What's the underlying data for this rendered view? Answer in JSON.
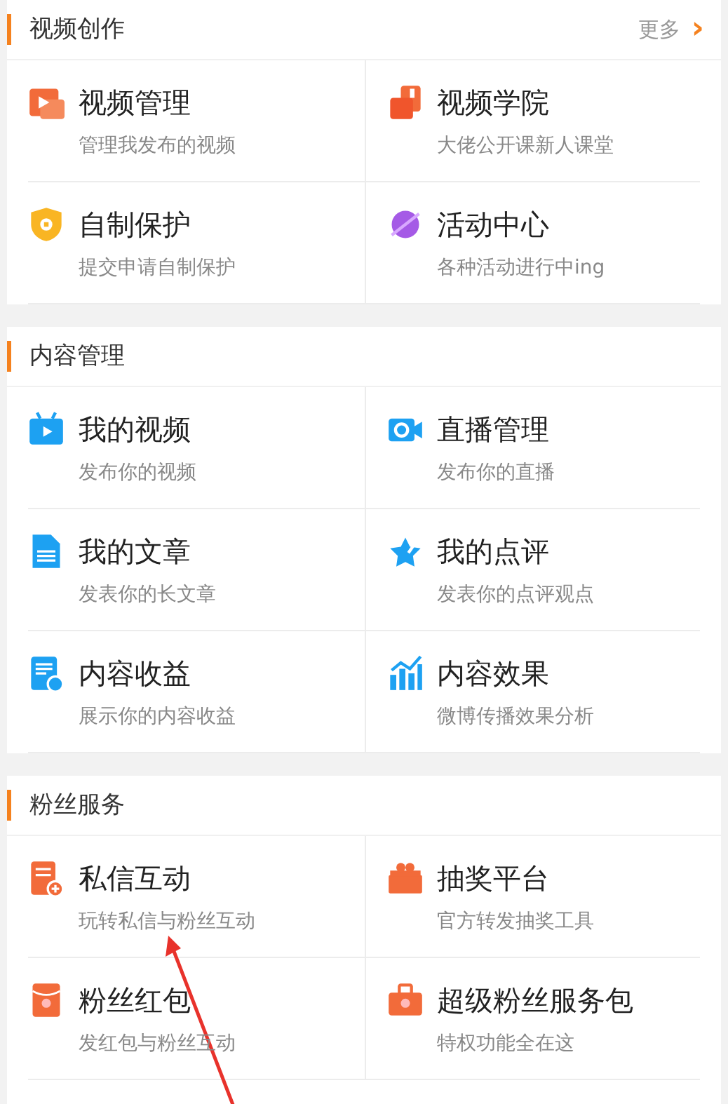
{
  "sections": [
    {
      "title": "视频创作",
      "more": {
        "label": "更多",
        "icon": "›"
      },
      "items": [
        {
          "kind": "play-folder",
          "title": "视频管理",
          "subtitle": "管理我发布的视频"
        },
        {
          "kind": "book",
          "title": "视频学院",
          "subtitle": "大佬公开课新人课堂"
        },
        {
          "kind": "shield",
          "title": "自制保护",
          "subtitle": "提交申请自制保护"
        },
        {
          "kind": "planet",
          "title": "活动中心",
          "subtitle": "各种活动进行中ing"
        }
      ]
    },
    {
      "title": "内容管理",
      "items": [
        {
          "kind": "tv",
          "title": "我的视频",
          "subtitle": "发布你的视频"
        },
        {
          "kind": "camera",
          "title": "直播管理",
          "subtitle": "发布你的直播"
        },
        {
          "kind": "document",
          "title": "我的文章",
          "subtitle": "发表你的长文章"
        },
        {
          "kind": "star",
          "title": "我的点评",
          "subtitle": "发表你的点评观点"
        },
        {
          "kind": "doc-yen",
          "title": "内容收益",
          "subtitle": "展示你的内容收益"
        },
        {
          "kind": "chart",
          "title": "内容效果",
          "subtitle": "微博传播效果分析"
        }
      ]
    },
    {
      "title": "粉丝服务",
      "items": [
        {
          "kind": "message-plus",
          "title": "私信互动",
          "subtitle": "玩转私信与粉丝互动"
        },
        {
          "kind": "gift",
          "title": "抽奖平台",
          "subtitle": "官方转发抽奖工具"
        },
        {
          "kind": "envelope",
          "title": "粉丝红包",
          "subtitle": "发红包与粉丝互动"
        },
        {
          "kind": "briefcase",
          "title": "超级粉丝服务包",
          "subtitle": "特权功能全在这"
        }
      ]
    }
  ]
}
